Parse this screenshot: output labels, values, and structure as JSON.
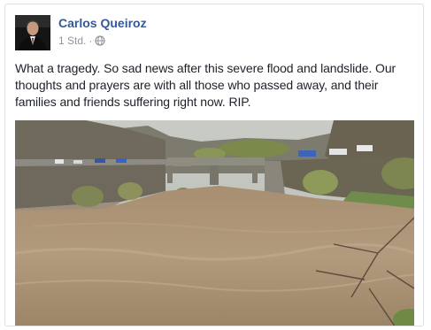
{
  "post": {
    "author": "Carlos Queiroz",
    "time": "1 Std.",
    "separator": "·",
    "privacy_icon": "globe-icon",
    "text": "What a tragedy. So sad news after this severe flood and landslide. Our thoughts and prayers are with all those who passed away, and their families and friends suffering right now. RIP.",
    "photo_icon": "flood-photo"
  },
  "colors": {
    "author": "#365899",
    "meta": "#90949c",
    "text": "#1d2129",
    "border": "#dddfe2"
  }
}
